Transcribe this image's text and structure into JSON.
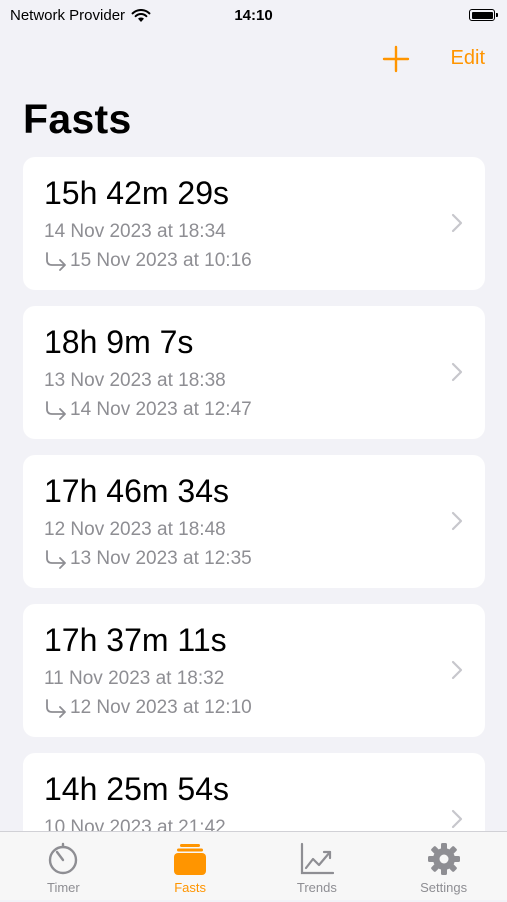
{
  "status_bar": {
    "carrier": "Network Provider",
    "time": "14:10"
  },
  "nav": {
    "edit_label": "Edit"
  },
  "page": {
    "title": "Fasts"
  },
  "fasts": [
    {
      "duration": "15h 42m 29s",
      "start": "14 Nov 2023 at 18:34",
      "end": "15 Nov 2023 at 10:16"
    },
    {
      "duration": "18h 9m 7s",
      "start": "13 Nov 2023 at 18:38",
      "end": "14 Nov 2023 at 12:47"
    },
    {
      "duration": "17h 46m 34s",
      "start": "12 Nov 2023 at 18:48",
      "end": "13 Nov 2023 at 12:35"
    },
    {
      "duration": "17h 37m 11s",
      "start": "11 Nov 2023 at 18:32",
      "end": "12 Nov 2023 at 12:10"
    },
    {
      "duration": "14h 25m 54s",
      "start": "10 Nov 2023 at 21:42",
      "end": ""
    }
  ],
  "tabs": [
    {
      "label": "Timer",
      "icon": "timer-icon"
    },
    {
      "label": "Fasts",
      "icon": "stack-icon"
    },
    {
      "label": "Trends",
      "icon": "chart-icon"
    },
    {
      "label": "Settings",
      "icon": "gear-icon"
    }
  ],
  "colors": {
    "accent": "#ff9500",
    "inactive": "#8e8e93",
    "background": "#f2f2f7"
  }
}
